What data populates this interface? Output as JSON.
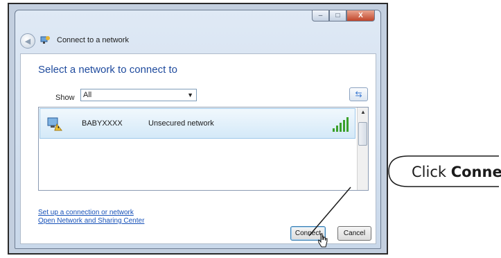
{
  "window": {
    "title": "Connect to a network",
    "controls": {
      "minimize": "–",
      "maximize": "□",
      "close": "X"
    }
  },
  "content": {
    "heading": "Select a network to connect to",
    "show_label": "Show",
    "filter_value": "All",
    "networks": [
      {
        "ssid": "BABYXXXX",
        "security": "Unsecured network",
        "signal_bars": 5
      }
    ]
  },
  "links": {
    "setup": "Set up a connection or network",
    "sharing_center": "Open Network and Sharing Center"
  },
  "buttons": {
    "connect": "Connect",
    "cancel": "Cancel"
  },
  "callout": {
    "prefix": "Click ",
    "bold": "Connect"
  },
  "colors": {
    "heading": "#1e4a9d",
    "link": "#1550b8",
    "signal": "#3aa02a",
    "selection": "#d4e9f8"
  }
}
